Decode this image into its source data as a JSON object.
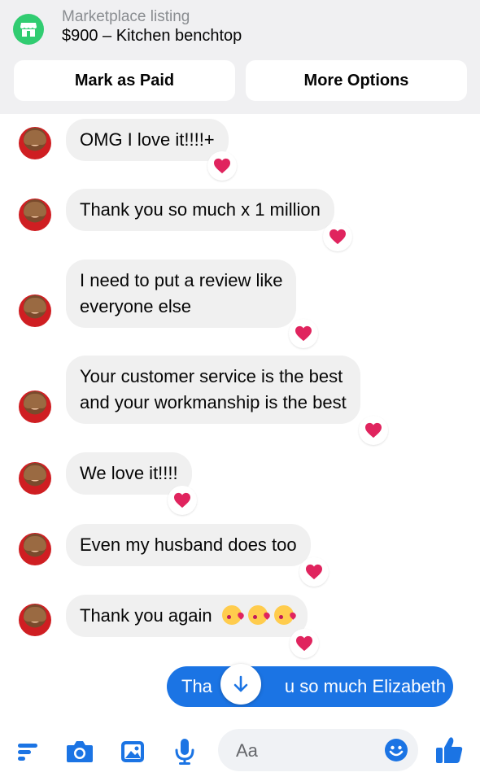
{
  "header": {
    "listing_label": "Marketplace listing",
    "listing_title": "$900 – Kitchen benchtop",
    "mark_paid_label": "Mark as Paid",
    "more_options_label": "More Options"
  },
  "messages": [
    {
      "text": "OMG I love it!!!!+",
      "reaction": "heart"
    },
    {
      "text": "Thank you so much x 1 million",
      "reaction": "heart"
    },
    {
      "lines": [
        "I need to put a review like",
        "everyone else"
      ],
      "reaction": "heart"
    },
    {
      "lines": [
        "Your customer service is the best",
        "and your workmanship is the best"
      ],
      "reaction": "heart"
    },
    {
      "text": "We love it!!!!",
      "reaction": "heart"
    },
    {
      "text": "Even my husband does too",
      "reaction": "heart"
    },
    {
      "text": "Thank you again",
      "emojis": [
        "kissing-heart",
        "kissing-heart",
        "kissing-heart"
      ],
      "reaction": "heart"
    }
  ],
  "outgoing": {
    "text_left": "Tha",
    "text_right": "u so much Elizabeth"
  },
  "composer": {
    "placeholder": "Aa"
  },
  "colors": {
    "accent": "#1b74e4",
    "marketplace_green": "#31cc71",
    "heart": "#e0245e",
    "bubble_bg": "#f0f0f0"
  }
}
